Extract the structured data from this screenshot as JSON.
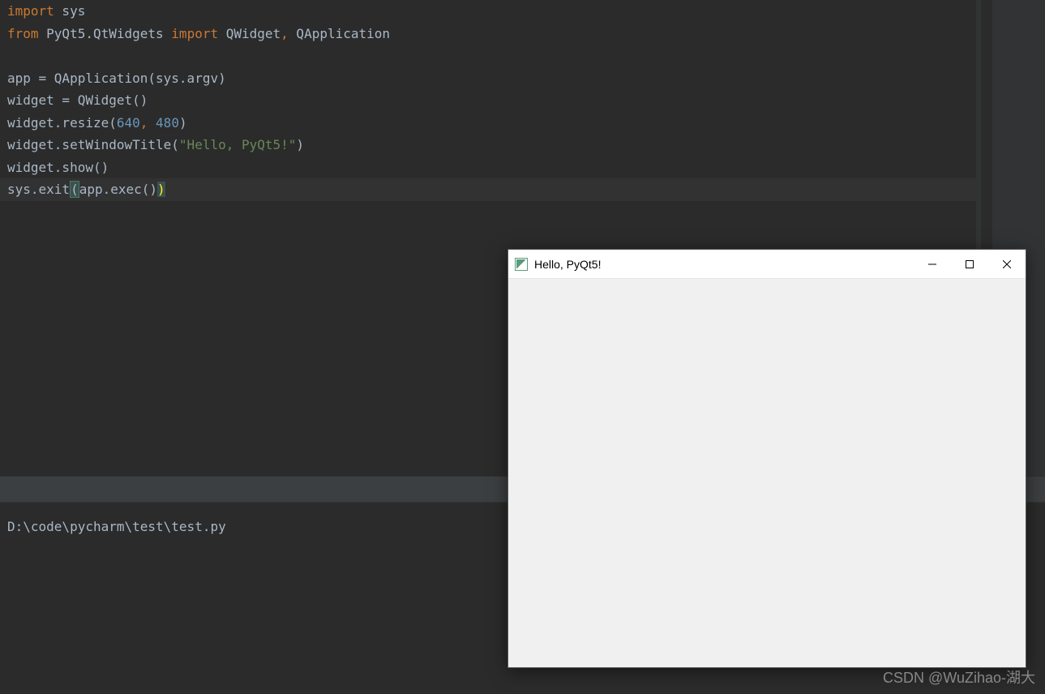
{
  "code": {
    "line1": {
      "import_kw": "import",
      "module": " sys"
    },
    "line2": {
      "from_kw": "from",
      "module": " PyQt5.QtWidgets ",
      "import_kw": "import",
      "items": " QWidget",
      "comma": ",",
      "items2": " QApplication"
    },
    "line3": "",
    "line4": {
      "pre": "app = QApplication(sys.argv)",
      "var": "app ",
      "eq": "= ",
      "call": "QApplication(sys.argv)"
    },
    "line5": {
      "text": "widget = QWidget()"
    },
    "line6": {
      "pre": "widget.resize(",
      "num1": "640",
      "comma": ",",
      "space": " ",
      "num2": "480",
      "close": ")"
    },
    "line7": {
      "pre": "widget.setWindowTitle(",
      "str": "\"Hello, PyQt5!\"",
      "close": ")"
    },
    "line8": {
      "text": "widget.show()"
    },
    "line9": {
      "pre": "sys.exit",
      "open_paren": "(",
      "mid": "app.exec()",
      "close_paren": ")"
    }
  },
  "terminal": {
    "path": "D:\\code\\pycharm\\test\\test.py"
  },
  "popup": {
    "title": "Hello, PyQt5!"
  },
  "watermark": "CSDN @WuZihao-湖大",
  "colors": {
    "keyword": "#CC7832",
    "default": "#A9B7C6",
    "number": "#6897BB",
    "string": "#6A8759",
    "background": "#2B2B2B",
    "panel": "#3C3F41"
  }
}
